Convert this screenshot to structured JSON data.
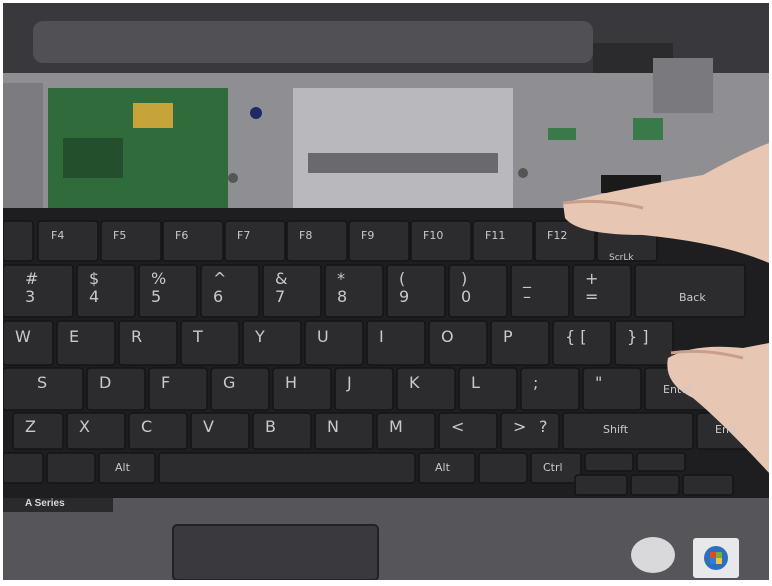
{
  "scene": {
    "description_tag": "laptop-keyboard-removal-photo"
  },
  "keys": {
    "fn_row": [
      "F4",
      "F5",
      "F6",
      "F7",
      "F8",
      "F9",
      "F10",
      "F11",
      "F12",
      "ScrLk"
    ],
    "number_row": [
      {
        "top": "#",
        "bottom": "3"
      },
      {
        "top": "$",
        "bottom": "4"
      },
      {
        "top": "%",
        "bottom": "5"
      },
      {
        "top": "^",
        "bottom": "6"
      },
      {
        "top": "&",
        "bottom": "7"
      },
      {
        "top": "*",
        "bottom": "8"
      },
      {
        "top": "(",
        "bottom": "9"
      },
      {
        "top": ")",
        "bottom": "0"
      },
      {
        "top": "_",
        "bottom": "–"
      },
      {
        "top": "+",
        "bottom": "="
      },
      {
        "top": "",
        "bottom": "Back"
      }
    ],
    "qwerty_row": [
      "W",
      "E",
      "R",
      "T",
      "Y",
      "U",
      "I",
      "O",
      "P",
      "{ [",
      "} ]"
    ],
    "home_row": [
      "S",
      "D",
      "F",
      "G",
      "H",
      "J",
      "K",
      "L",
      ";",
      "\"",
      "Enter"
    ],
    "shift_row": [
      "Z",
      "X",
      "C",
      "V",
      "B",
      "N",
      "M",
      "<",
      ">",
      "?",
      "Shift",
      "End"
    ],
    "bottom_row": [
      "Alt",
      "Alt",
      "Ctrl"
    ]
  },
  "branding": {
    "series_text": "A Series"
  }
}
